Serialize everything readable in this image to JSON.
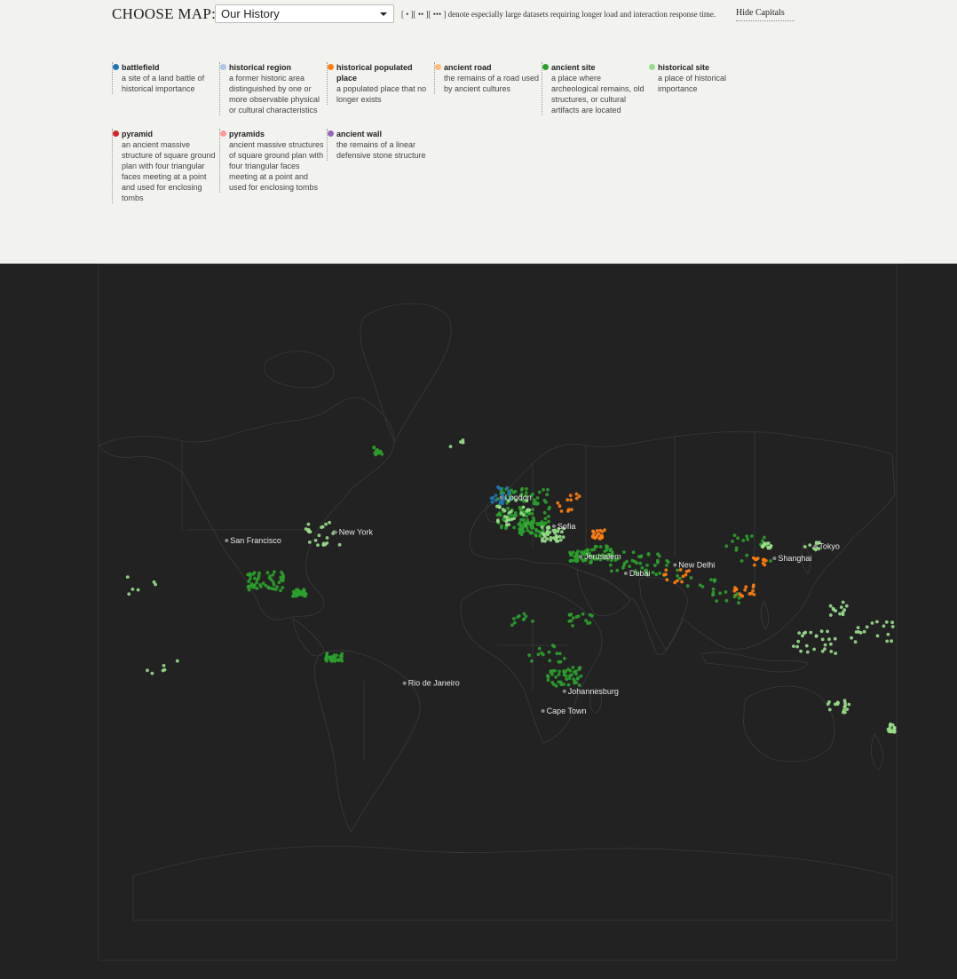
{
  "header": {
    "choose_label": "CHOOSE MAP:",
    "selected_map": "Our History",
    "note": "[ • ][ •• ][ ••• ] denote especially large datasets requiring longer load and interaction response time.",
    "hide_capitals": "Hide Capitals"
  },
  "legend": [
    {
      "title": "battlefield",
      "desc": "a site of a land battle of historical importance",
      "color": "#1f77b4"
    },
    {
      "title": "historical region",
      "desc": "a former historic area distinguished by one or more observable physical or cultural characteristics",
      "color": "#aec7e8"
    },
    {
      "title": "historical populated place",
      "desc": "a populated place that no longer exists",
      "color": "#ff7f0e"
    },
    {
      "title": "ancient road",
      "desc": "the remains of a road used by ancient cultures",
      "color": "#ffbb78"
    },
    {
      "title": "ancient site",
      "desc": "a place where archeological remains, old structures, or cultural artifacts are located",
      "color": "#2ca02c"
    },
    {
      "title": "historical site",
      "desc": "a place of historical importance",
      "color": "#98df8a"
    },
    {
      "title": "pyramid",
      "desc": "an ancient massive structure of square ground plan with four triangular faces meeting at a point and used for enclosing tombs",
      "color": "#d62728"
    },
    {
      "title": "pyramids",
      "desc": "ancient massive structures of square ground plan with four triangular faces meeting at a point and used for enclosing tombs",
      "color": "#ff9896"
    },
    {
      "title": "ancient wall",
      "desc": "the remains of a linear defensive stone structure",
      "color": "#9467bd"
    }
  ],
  "map": {
    "background": "#222222",
    "land_stroke": "#3a3a3a",
    "capitals": [
      {
        "name": "London",
        "lon": -0.1,
        "lat": 51.5
      },
      {
        "name": "Sofia",
        "lon": 23.3,
        "lat": 42.7
      },
      {
        "name": "Jerusalem",
        "lon": 35.2,
        "lat": 31.8
      },
      {
        "name": "Dubai",
        "lon": 55.3,
        "lat": 25.2
      },
      {
        "name": "New Delhi",
        "lon": 77.2,
        "lat": 28.6
      },
      {
        "name": "Shanghai",
        "lon": 121.5,
        "lat": 31.2
      },
      {
        "name": "Tokyo",
        "lon": 139.7,
        "lat": 35.7
      },
      {
        "name": "San Francisco",
        "lon": -122.4,
        "lat": 37.8
      },
      {
        "name": "New York",
        "lon": -74.0,
        "lat": 40.7
      },
      {
        "name": "Rio de Janeiro",
        "lon": -43.2,
        "lat": -22.9
      },
      {
        "name": "Johannesburg",
        "lon": 28.0,
        "lat": -26.2
      },
      {
        "name": "Cape Town",
        "lon": 18.4,
        "lat": -33.9
      }
    ]
  }
}
